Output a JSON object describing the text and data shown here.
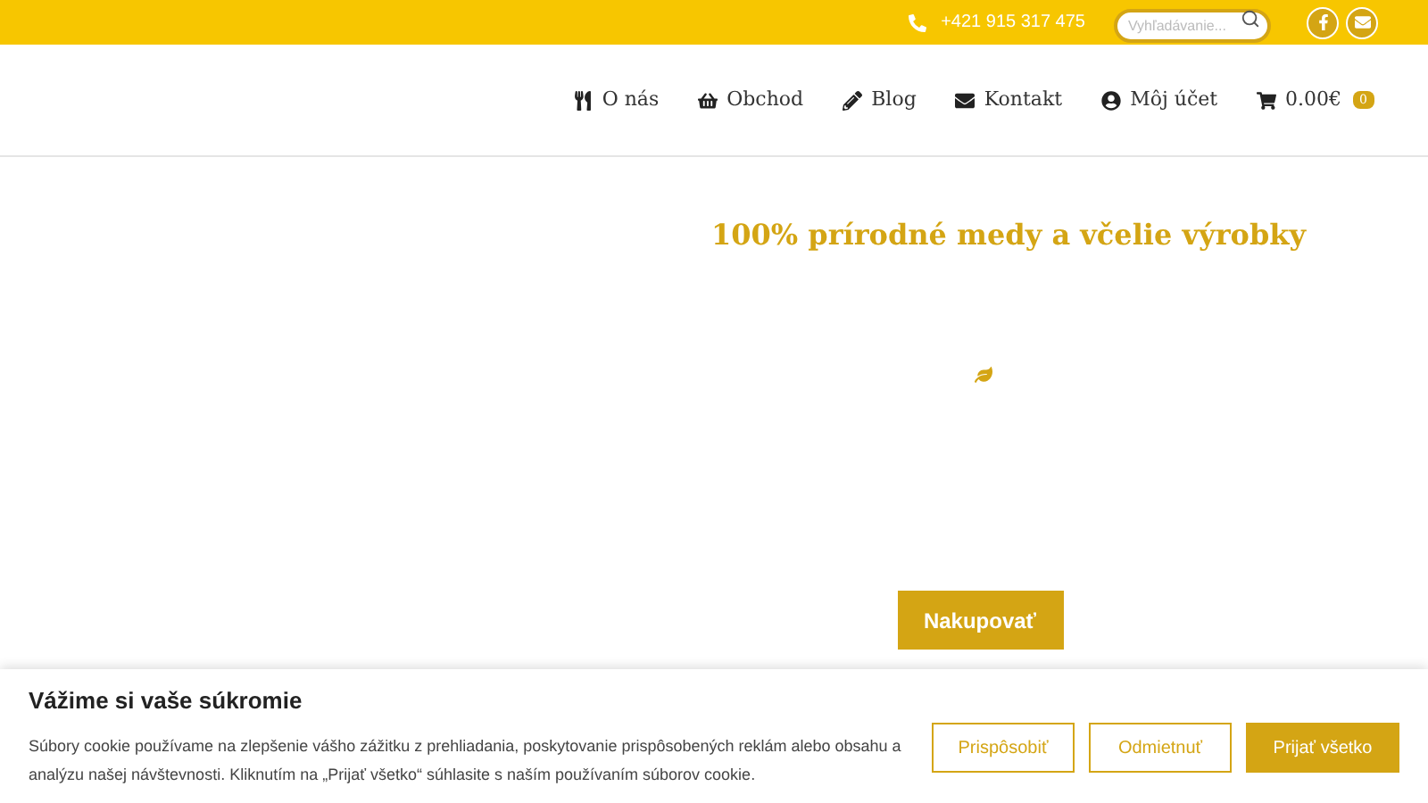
{
  "topbar": {
    "phone": "+421 915 317 475",
    "search": {
      "placeholder": "Vyhľadávanie..."
    }
  },
  "nav": [
    {
      "label": "O nás",
      "kind": "cutlery"
    },
    {
      "label": "Obchod",
      "kind": "basket"
    },
    {
      "label": "Blog",
      "kind": "pencil"
    },
    {
      "label": "Kontakt",
      "kind": "mail"
    },
    {
      "label": "Môj účet",
      "kind": "user"
    }
  ],
  "cart": {
    "total": "0.00€",
    "count": "0"
  },
  "hero": {
    "title": "100% prírodné medy a včelie výrobky",
    "button": "Nakupovať"
  },
  "cookie": {
    "title": "Vážime si vaše súkromie",
    "text": "Súbory cookie používame na zlepšenie vášho zážitku z prehliadania, poskytovanie prispôsobených reklám alebo obsahu a analýzu našej návštevnosti. Kliknutím na „Prijať všetko“ súhlasite s naším používaním súborov cookie.",
    "buttons": [
      {
        "label": "Prispôsobiť",
        "kind": "outline"
      },
      {
        "label": "Odmietnuť",
        "kind": "outline"
      },
      {
        "label": "Prijať všetko",
        "kind": "solid"
      }
    ]
  }
}
